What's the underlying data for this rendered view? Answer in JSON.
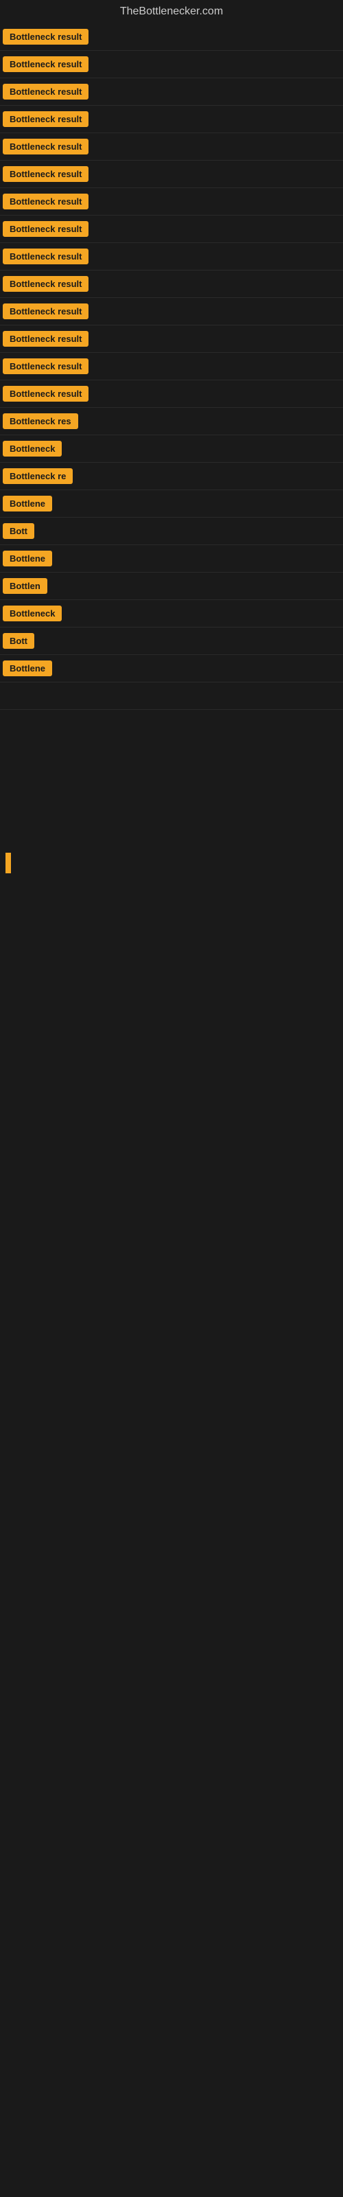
{
  "site": {
    "title": "TheBottlenecker.com"
  },
  "results": [
    {
      "id": 1,
      "label": "Bottleneck result",
      "width": 140,
      "visible": true
    },
    {
      "id": 2,
      "label": "Bottleneck result",
      "width": 140,
      "visible": true
    },
    {
      "id": 3,
      "label": "Bottleneck result",
      "width": 140,
      "visible": true
    },
    {
      "id": 4,
      "label": "Bottleneck result",
      "width": 140,
      "visible": true
    },
    {
      "id": 5,
      "label": "Bottleneck result",
      "width": 140,
      "visible": true
    },
    {
      "id": 6,
      "label": "Bottleneck result",
      "width": 140,
      "visible": true
    },
    {
      "id": 7,
      "label": "Bottleneck result",
      "width": 140,
      "visible": true
    },
    {
      "id": 8,
      "label": "Bottleneck result",
      "width": 140,
      "visible": true
    },
    {
      "id": 9,
      "label": "Bottleneck result",
      "width": 140,
      "visible": true
    },
    {
      "id": 10,
      "label": "Bottleneck result",
      "width": 140,
      "visible": true
    },
    {
      "id": 11,
      "label": "Bottleneck result",
      "width": 140,
      "visible": true
    },
    {
      "id": 12,
      "label": "Bottleneck result",
      "width": 140,
      "visible": true
    },
    {
      "id": 13,
      "label": "Bottleneck result",
      "width": 140,
      "visible": true
    },
    {
      "id": 14,
      "label": "Bottleneck result",
      "width": 140,
      "visible": true
    },
    {
      "id": 15,
      "label": "Bottleneck res",
      "width": 120,
      "visible": true
    },
    {
      "id": 16,
      "label": "Bottleneck",
      "width": 90,
      "visible": true
    },
    {
      "id": 17,
      "label": "Bottleneck re",
      "width": 105,
      "visible": true
    },
    {
      "id": 18,
      "label": "Bottlene",
      "width": 78,
      "visible": true
    },
    {
      "id": 19,
      "label": "Bott",
      "width": 50,
      "visible": true
    },
    {
      "id": 20,
      "label": "Bottlene",
      "width": 78,
      "visible": true
    },
    {
      "id": 21,
      "label": "Bottlen",
      "width": 72,
      "visible": true
    },
    {
      "id": 22,
      "label": "Bottleneck",
      "width": 90,
      "visible": true
    },
    {
      "id": 23,
      "label": "Bott",
      "width": 50,
      "visible": true
    },
    {
      "id": 24,
      "label": "Bottlene",
      "width": 78,
      "visible": true
    },
    {
      "id": 25,
      "label": "",
      "width": 0,
      "visible": false,
      "indicator": true
    }
  ],
  "colors": {
    "badge_bg": "#f5a623",
    "badge_text": "#1a1a1a",
    "page_bg": "#1a1a1a",
    "title_color": "#cccccc"
  }
}
